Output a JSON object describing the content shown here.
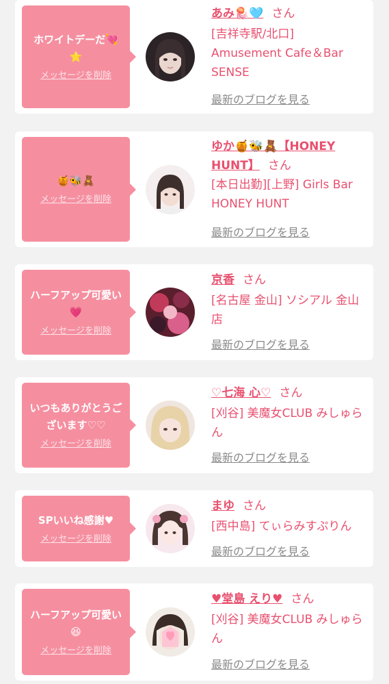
{
  "delete_label": "メッセージを削除",
  "blog_label": "最新のブログを見る",
  "san_label": "さん",
  "colors": {
    "accent": "#e8506f",
    "bubble": "#f58fa0",
    "background": "#f2f2f2"
  },
  "cards": [
    {
      "message": "ホワイトデーだ💘⭐",
      "name": "あみ🪼🩵",
      "shop": "[吉祥寺駅/北口] Amusement Cafe＆Bar SENSE"
    },
    {
      "message": "🍯🐝🧸",
      "name": "ゆか🍯🐝🧸【HONEY HUNT】",
      "shop": "[本日出勤][上野] Girls Bar HONEY HUNT"
    },
    {
      "message": "ハーフアップ可愛い💗",
      "name": "京香",
      "shop": "[名古屋 金山] ソシアル 金山店"
    },
    {
      "message": "いつもありがとうございます♡♡",
      "name": "♡七海 心♡",
      "shop": "[刈谷] 美魔女CLUB みしゅらん"
    },
    {
      "message": "SPいいね感謝♥",
      "name": "まゆ",
      "shop": "[西中島] てぃらみすぷりん"
    },
    {
      "message": "ハーフアップ可愛い😆",
      "name": "♥堂島 えり♥",
      "shop": "[刈谷] 美魔女CLUB みしゅらん"
    }
  ]
}
